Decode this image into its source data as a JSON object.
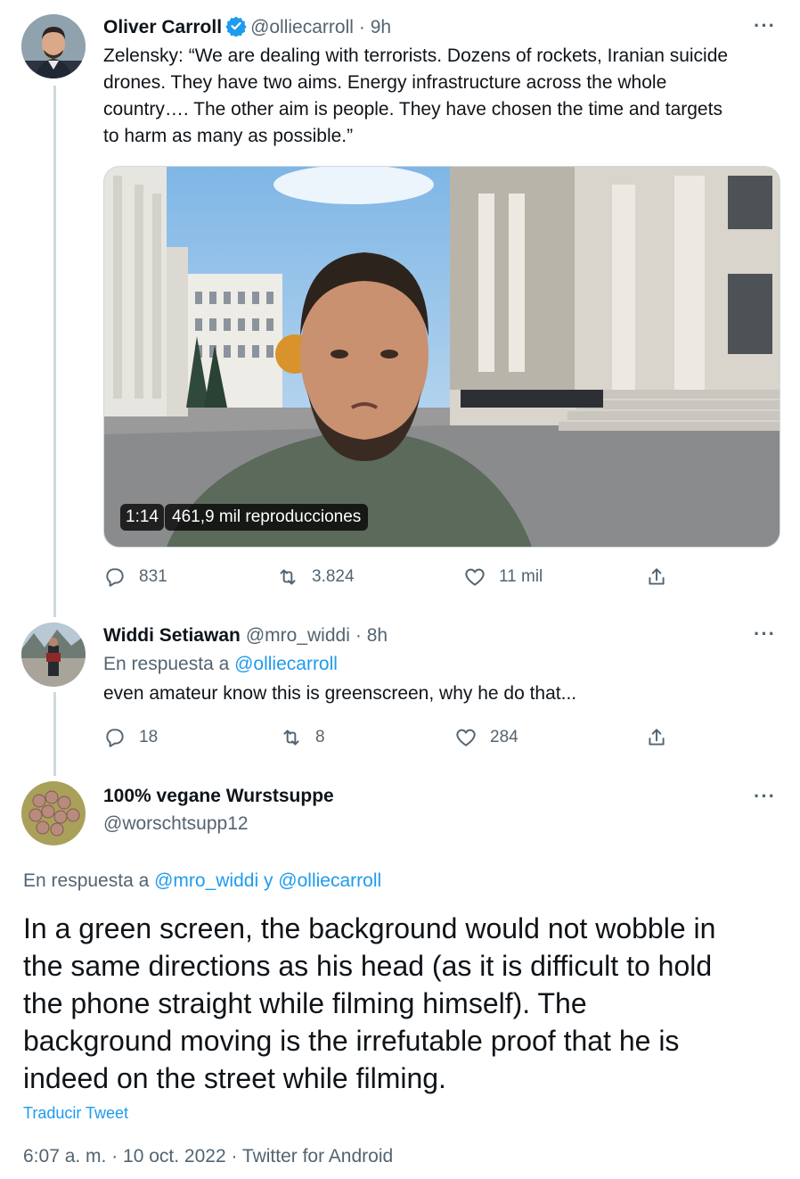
{
  "tweet1": {
    "name": "Oliver Carroll",
    "handle": "@olliecarroll",
    "time": "· 9h",
    "more": "···",
    "text_lines": [
      "Zelensky: “We are dealing with terrorists. Dozens of rockets, Iranian suicide",
      "drones. They have two aims. Energy infrastructure across the whole",
      "country…. The other aim is people. They have chosen the time and targets",
      "to harm as many as possible.”"
    ],
    "video_duration": "1:14",
    "video_views": "461,9 mil reproducciones",
    "replies": "831",
    "retweets": "3.824",
    "likes": "11 mil"
  },
  "tweet2": {
    "name": "Widdi Setiawan",
    "handle": "@mro_widdi",
    "time": "· 8h",
    "more": "···",
    "reply_prefix": "En respuesta a ",
    "reply_to": "@olliecarroll",
    "text": "even amateur know this is greenscreen, why he do that...",
    "replies": "18",
    "retweets": "8",
    "likes": "284"
  },
  "tweet3": {
    "name": "100% vegane Wurstsuppe",
    "handle": "@worschtsupp12",
    "more": "···",
    "reply_prefix": "En respuesta a ",
    "reply_to_1": "@mro_widdi",
    "reply_and": " y ",
    "reply_to_2": "@olliecarroll",
    "text_lines": [
      "In a green screen, the background would not wobble in",
      "the same directions as his head (as it is difficult to hold",
      "the phone straight while filming himself). The",
      "background moving is the irrefutable proof that he is",
      "indeed on the street while filming."
    ],
    "translate": "Traducir Tweet",
    "timestamp": "6:07 a. m. · 10 oct. 2022 · Twitter for Android"
  },
  "icons": {
    "reply": "reply-icon",
    "retweet": "retweet-icon",
    "like": "heart-icon",
    "share": "share-icon",
    "verified": "verified-badge-icon"
  },
  "colors": {
    "text": "#0f1419",
    "secondary": "#536471",
    "link": "#1d9bf0",
    "thread_line": "#cfd9de"
  }
}
